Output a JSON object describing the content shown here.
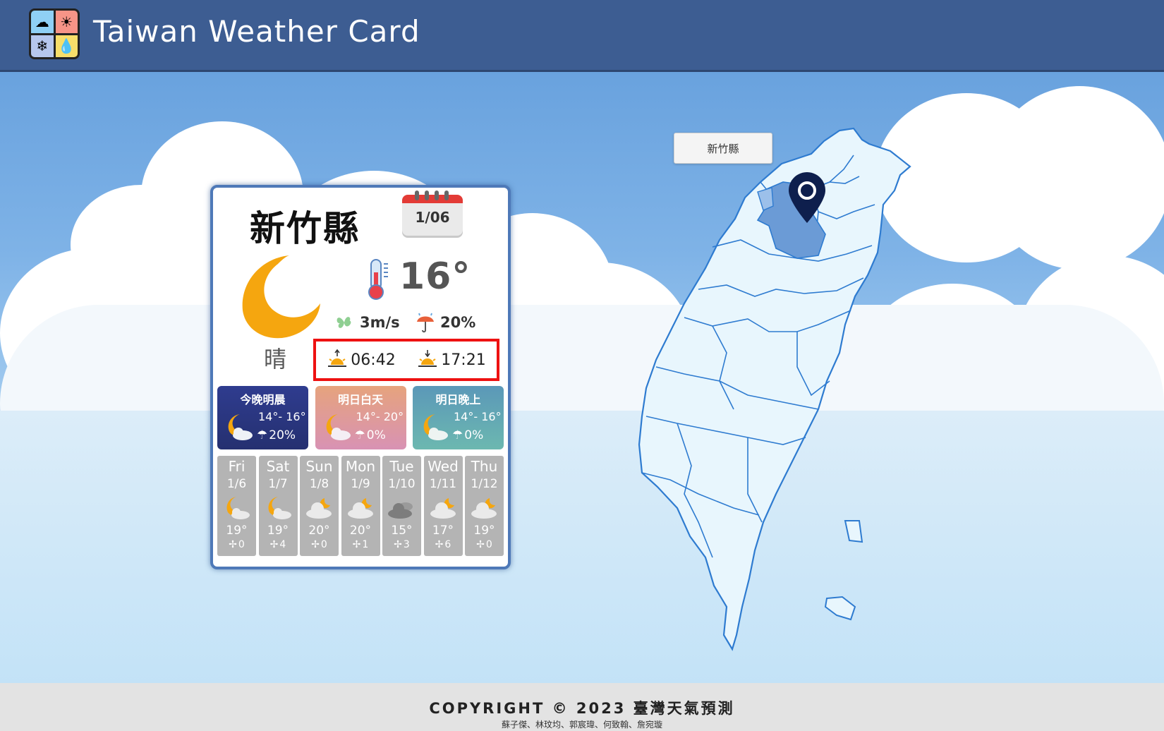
{
  "app": {
    "title": "Taiwan Weather Card"
  },
  "map": {
    "selected_region": "新竹縣"
  },
  "card": {
    "city": "新竹縣",
    "date": "1/06",
    "condition": "晴",
    "temperature": "16°",
    "wind": "3m/s",
    "rain_chance": "20%",
    "sunrise": "06:42",
    "sunset": "17:21",
    "periods": [
      {
        "title": "今晚明晨",
        "temp": "14°- 16°",
        "rain": "20%",
        "icon": "moon-cloud-icon"
      },
      {
        "title": "明日白天",
        "temp": "14°- 20°",
        "rain": "0%",
        "icon": "moon-cloud-icon"
      },
      {
        "title": "明日晚上",
        "temp": "14°- 16°",
        "rain": "0%",
        "icon": "moon-cloud-icon"
      }
    ],
    "days": [
      {
        "name": "Fri",
        "date": "1/6",
        "temp": "19°",
        "wind": "0",
        "icon": "moon-cloud-icon"
      },
      {
        "name": "Sat",
        "date": "1/7",
        "temp": "19°",
        "wind": "4",
        "icon": "moon-cloud-icon"
      },
      {
        "name": "Sun",
        "date": "1/8",
        "temp": "20°",
        "wind": "0",
        "icon": "cloud-moon-icon"
      },
      {
        "name": "Mon",
        "date": "1/9",
        "temp": "20°",
        "wind": "1",
        "icon": "cloud-moon-icon"
      },
      {
        "name": "Tue",
        "date": "1/10",
        "temp": "15°",
        "wind": "3",
        "icon": "dark-cloud-icon"
      },
      {
        "name": "Wed",
        "date": "1/11",
        "temp": "17°",
        "wind": "6",
        "icon": "cloud-moon-icon"
      },
      {
        "name": "Thu",
        "date": "1/12",
        "temp": "19°",
        "wind": "0",
        "icon": "cloud-moon-icon"
      }
    ]
  },
  "footer": {
    "copyright": "COPYRIGHT © 2023 臺灣天氣預測",
    "authors": "蘇子傑、林玟均、郭宸瑋、何致翰、詹宛璇"
  },
  "colors": {
    "header": "#3d5d92",
    "accent_red": "#ee1111",
    "moon": "#f5a60f",
    "selected_county": "#6b9bd6"
  }
}
